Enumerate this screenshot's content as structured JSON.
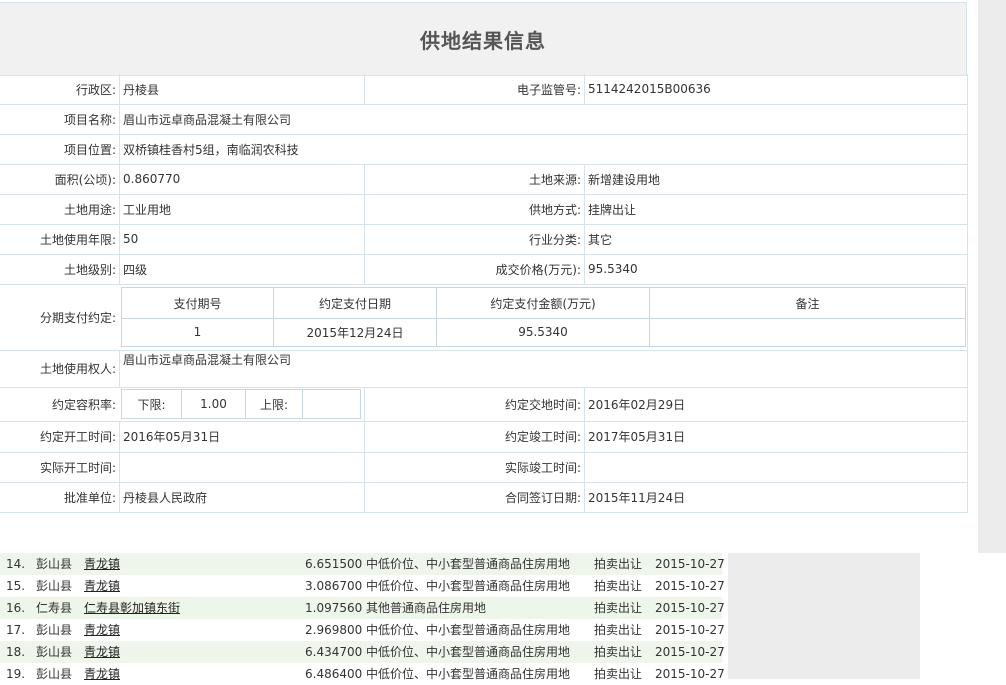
{
  "title": "供地结果信息",
  "fields": {
    "district_label": "行政区:",
    "district": "丹棱县",
    "supervision_no_label": "电子监管号:",
    "supervision_no": "5114242015B00636",
    "project_name_label": "项目名称:",
    "project_name": "眉山市远卓商品混凝土有限公司",
    "project_location_label": "项目位置:",
    "project_location": "双桥镇桂香村5组，南临润农科技",
    "area_label": "面积(公顷):",
    "area": "0.860770",
    "land_source_label": "土地来源:",
    "land_source": "新增建设用地",
    "land_use_label": "土地用途:",
    "land_use": "工业用地",
    "supply_method_label": "供地方式:",
    "supply_method": "挂牌出让",
    "term_label": "土地使用年限:",
    "term": "50",
    "industry_label": "行业分类:",
    "industry": "其它",
    "grade_label": "土地级别:",
    "grade": "四级",
    "price_label": "成交价格(万元):",
    "price": "95.5340",
    "installment_label": "分期支付约定:",
    "holder_label": "土地使用权人:",
    "holder": "眉山市远卓商品混凝土有限公司",
    "ratio_label": "约定容积率:",
    "ratio_lower_label": "下限:",
    "ratio_lower": "1.00",
    "ratio_upper_label": "上限:",
    "ratio_upper": "",
    "delivery_label": "约定交地时间:",
    "delivery": "2016年02月29日",
    "start_label": "约定开工时间:",
    "start": "2016年05月31日",
    "finish_label": "约定竣工时间:",
    "finish": "2017年05月31日",
    "actual_start_label": "实际开工时间:",
    "actual_start": "",
    "actual_finish_label": "实际竣工时间:",
    "actual_finish": "",
    "approver_label": "批准单位:",
    "approver": "丹棱县人民政府",
    "contract_date_label": "合同签订日期:",
    "contract_date": "2015年11月24日"
  },
  "payment": {
    "headers": [
      "支付期号",
      "约定支付日期",
      "约定支付金额(万元)",
      "备注"
    ],
    "rows": [
      [
        "1",
        "2015年12月24日",
        "95.5340",
        ""
      ]
    ]
  },
  "list": [
    {
      "no": "14.",
      "county": "彭山县",
      "town": "青龙镇",
      "area": "6.651500",
      "use": "中低价位、中小套型普通商品住房用地",
      "method": "拍卖出让",
      "date": "2015-10-27"
    },
    {
      "no": "15.",
      "county": "彭山县",
      "town": "青龙镇",
      "area": "3.086700",
      "use": "中低价位、中小套型普通商品住房用地",
      "method": "拍卖出让",
      "date": "2015-10-27"
    },
    {
      "no": "16.",
      "county": "仁寿县",
      "town": "仁寿县彰加镇东街",
      "area": "1.097560",
      "use": "其他普通商品住房用地",
      "method": "拍卖出让",
      "date": "2015-10-27"
    },
    {
      "no": "17.",
      "county": "彭山县",
      "town": "青龙镇",
      "area": "2.969800",
      "use": "中低价位、中小套型普通商品住房用地",
      "method": "拍卖出让",
      "date": "2015-10-27"
    },
    {
      "no": "18.",
      "county": "彭山县",
      "town": "青龙镇",
      "area": "6.434700",
      "use": "中低价位、中小套型普通商品住房用地",
      "method": "拍卖出让",
      "date": "2015-10-27"
    },
    {
      "no": "19.",
      "county": "彭山县",
      "town": "青龙镇",
      "area": "6.486400",
      "use": "中低价位、中小套型普通商品住房用地",
      "method": "拍卖出让",
      "date": "2015-10-27"
    }
  ]
}
